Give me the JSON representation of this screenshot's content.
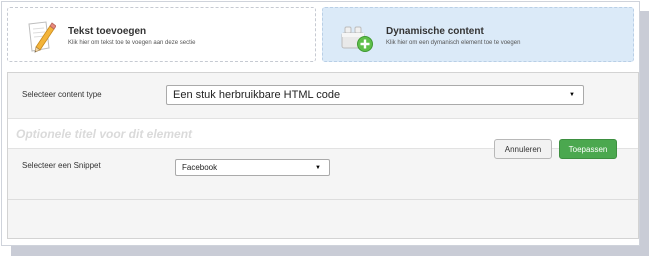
{
  "cards": {
    "text": {
      "title": "Tekst toevoegen",
      "subtitle": "Klik hier om tekst toe te voegen aan deze sectie",
      "icon": "pencil-note-icon"
    },
    "dynamic": {
      "title": "Dynamische content",
      "subtitle": "Klik hier om een dymanisch element toe te voegen",
      "icon": "blocks-add-icon"
    }
  },
  "form": {
    "content_type_label": "Selecteer content type",
    "content_type_value": "Een stuk herbruikbare HTML code",
    "title_placeholder": "Optionele titel voor dit element",
    "snippet_label": "Selecteer een Snippet",
    "snippet_value": "Facebook"
  },
  "actions": {
    "cancel_label": "Annuleren",
    "apply_label": "Toepassen"
  },
  "colors": {
    "selected_card_bg": "#dbeaf8",
    "apply_button": "#4ba84f",
    "panel_bg": "#f5f5f5"
  }
}
